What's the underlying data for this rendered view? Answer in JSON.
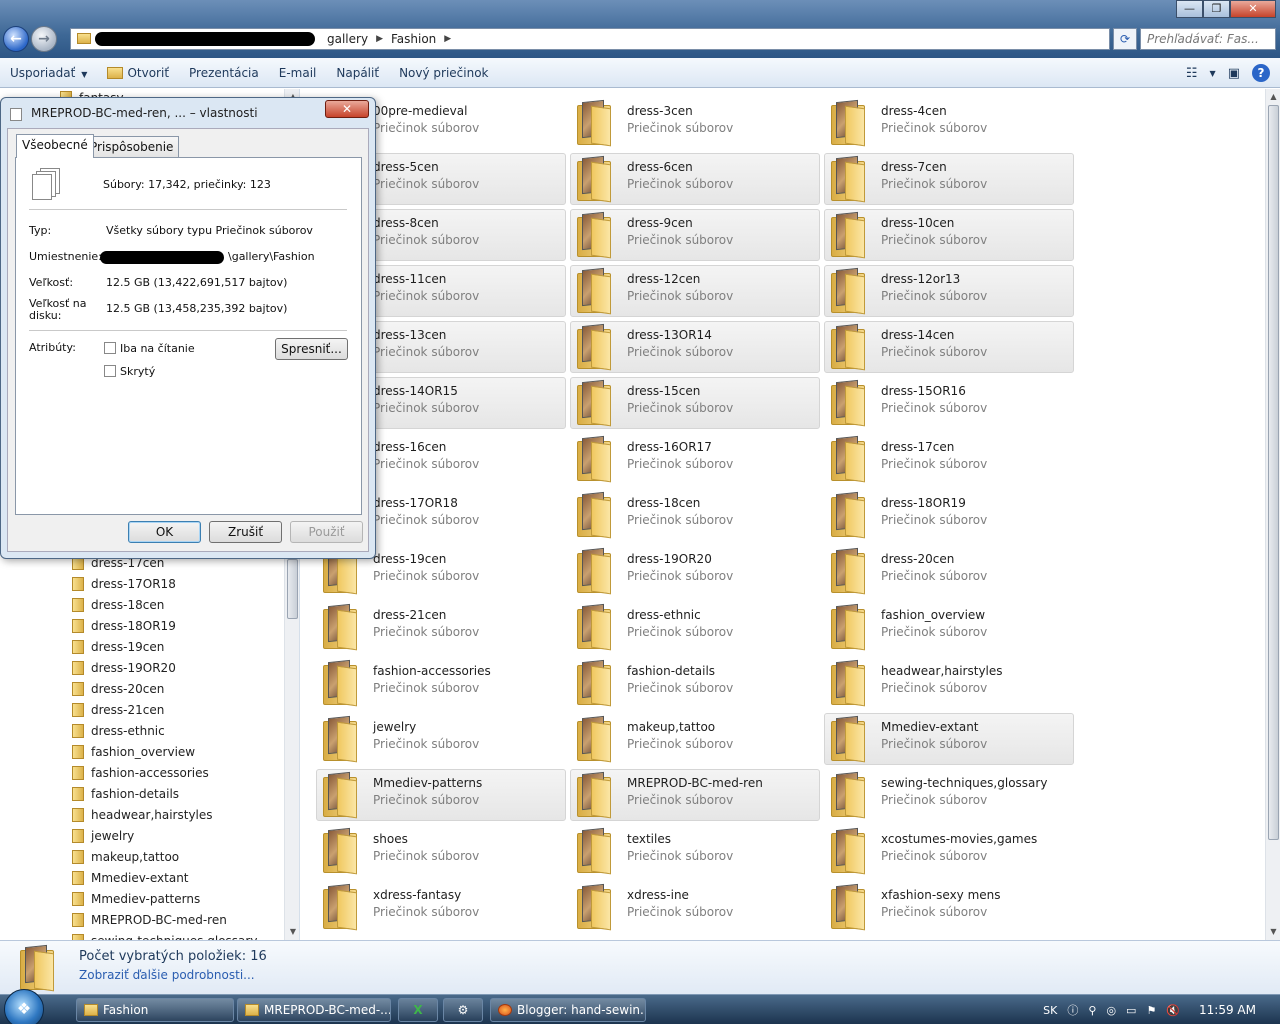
{
  "titlebar": {
    "minimize": "—",
    "maximize": "❐",
    "close": "✕"
  },
  "nav_buttons": {
    "back": "←",
    "forward": "→"
  },
  "address": {
    "crumbs": [
      "gallery",
      "Fashion"
    ],
    "refresh": "⟳"
  },
  "search": {
    "placeholder": "Prehľadávať: Fas..."
  },
  "toolbar": {
    "organize": "Usporiadať",
    "open": "Otvoriť",
    "slideshow": "Prezentácia",
    "email": "E-mail",
    "burn": "Napáliť",
    "new_folder": "Nový priečinok",
    "views_icon": "☷",
    "preview_icon": "▣",
    "help": "?"
  },
  "nav_pane": {
    "items": [
      "dress-17cen",
      "dress-17OR18",
      "dress-18cen",
      "dress-18OR19",
      "dress-19cen",
      "dress-19OR20",
      "dress-20cen",
      "dress-21cen",
      "dress-ethnic",
      "fashion_overview",
      "fashion-accessories",
      "fashion-details",
      "headwear,hairstyles",
      "jewelry",
      "makeup,tattoo",
      "Mmediev-extant",
      "Mmediev-patterns",
      "MREPROD-BC-med-ren",
      "sewing-techniques,glossary"
    ],
    "top_item": "fantasy"
  },
  "content": {
    "type_label": "Priečinok súborov",
    "folders": [
      {
        "name": "00pre-medieval",
        "sel": false
      },
      {
        "name": "dress-3cen",
        "sel": false
      },
      {
        "name": "dress-4cen",
        "sel": false
      },
      {
        "name": "dress-5cen",
        "sel": true
      },
      {
        "name": "dress-6cen",
        "sel": true
      },
      {
        "name": "dress-7cen",
        "sel": true
      },
      {
        "name": "dress-8cen",
        "sel": true
      },
      {
        "name": "dress-9cen",
        "sel": true
      },
      {
        "name": "dress-10cen",
        "sel": true
      },
      {
        "name": "dress-11cen",
        "sel": true
      },
      {
        "name": "dress-12cen",
        "sel": true
      },
      {
        "name": "dress-12or13",
        "sel": true
      },
      {
        "name": "dress-13cen",
        "sel": true
      },
      {
        "name": "dress-13OR14",
        "sel": true
      },
      {
        "name": "dress-14cen",
        "sel": true
      },
      {
        "name": "dress-14OR15",
        "sel": true
      },
      {
        "name": "dress-15cen",
        "sel": true
      },
      {
        "name": "dress-15OR16",
        "sel": false
      },
      {
        "name": "dress-16cen",
        "sel": false
      },
      {
        "name": "dress-16OR17",
        "sel": false
      },
      {
        "name": "dress-17cen",
        "sel": false
      },
      {
        "name": "dress-17OR18",
        "sel": false
      },
      {
        "name": "dress-18cen",
        "sel": false
      },
      {
        "name": "dress-18OR19",
        "sel": false
      },
      {
        "name": "dress-19cen",
        "sel": false
      },
      {
        "name": "dress-19OR20",
        "sel": false
      },
      {
        "name": "dress-20cen",
        "sel": false
      },
      {
        "name": "dress-21cen",
        "sel": false
      },
      {
        "name": "dress-ethnic",
        "sel": false
      },
      {
        "name": "fashion_overview",
        "sel": false
      },
      {
        "name": "fashion-accessories",
        "sel": false
      },
      {
        "name": "fashion-details",
        "sel": false
      },
      {
        "name": "headwear,hairstyles",
        "sel": false
      },
      {
        "name": "jewelry",
        "sel": false
      },
      {
        "name": "makeup,tattoo",
        "sel": false
      },
      {
        "name": "Mmediev-extant",
        "sel": true
      },
      {
        "name": "Mmediev-patterns",
        "sel": true
      },
      {
        "name": "MREPROD-BC-med-ren",
        "sel": true
      },
      {
        "name": "sewing-techniques,glossary",
        "sel": false
      },
      {
        "name": "shoes",
        "sel": false
      },
      {
        "name": "textiles",
        "sel": false
      },
      {
        "name": "xcostumes-movies,games",
        "sel": false
      },
      {
        "name": "xdress-fantasy",
        "sel": false
      },
      {
        "name": "xdress-ine",
        "sel": false
      },
      {
        "name": "xfashion-sexy mens",
        "sel": false
      }
    ]
  },
  "details": {
    "count": "Počet vybratých položiek: 16",
    "more": "Zobraziť ďalšie podrobnosti..."
  },
  "dialog": {
    "title": "MREPROD-BC-med-ren, ... – vlastnosti",
    "close": "✕",
    "tabs": [
      "Všeobecné",
      "Prispôsobenie"
    ],
    "summary": "Súbory: 17,342, priečinky: 123",
    "type_label": "Typ:",
    "type_value": "Všetky súbory typu Priečinok súborov",
    "location_label": "Umiestnenie:",
    "location_value": "\\gallery\\Fashion",
    "size_label": "Veľkosť:",
    "size_value": "12.5 GB (13,422,691,517 bajtov)",
    "disk_label": "Veľkosť na disku:",
    "disk_value": "12.5 GB (13,458,235,392 bajtov)",
    "attr_label": "Atribúty:",
    "readonly": "Iba na čítanie",
    "hidden": "Skrytý",
    "advanced": "Spresniť...",
    "ok": "OK",
    "cancel": "Zrušiť",
    "apply": "Použiť"
  },
  "taskbar": {
    "start": "❖",
    "items": [
      "Fashion",
      "MREPROD-BC-med-...",
      "Blogger: hand-sewin..."
    ],
    "excel": "X",
    "lang": "SK",
    "clock": "11:59 AM"
  }
}
